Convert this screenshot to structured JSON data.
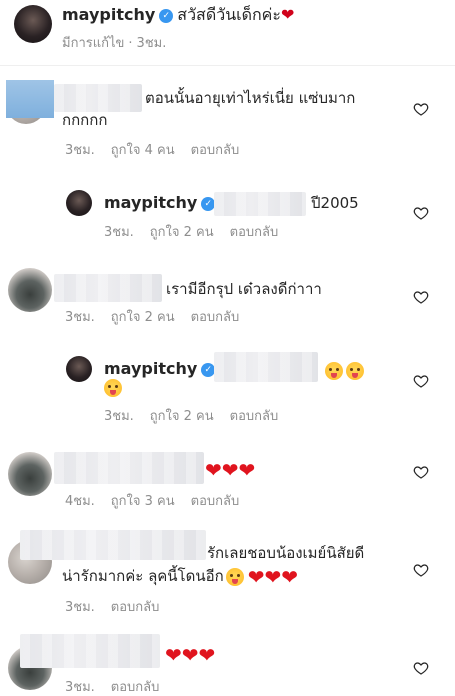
{
  "caption": {
    "username": "maypitchy",
    "text": "สวัสดีวันเด็กค่ะ",
    "heart": "❤",
    "edited": "มีการแก้ไข",
    "sep": "·",
    "time": "3ชม."
  },
  "comments": [
    {
      "text_line1": "ตอนนั้นอายุเท่าไหร่เนี่ย แซ่บมาก",
      "text_line2": "กกกกก",
      "time": "3ชม.",
      "likes": "ถูกใจ 4 คน",
      "reply": "ตอบกลับ"
    },
    {
      "username": "maypitchy",
      "text": "ปี2005",
      "time": "3ชม.",
      "likes": "ถูกใจ 2 คน",
      "reply": "ตอบกลับ"
    },
    {
      "text": "เรามีอีกรุป เด๋วลงดีก่าาา",
      "time": "3ชม.",
      "likes": "ถูกใจ 2 คน",
      "reply": "ตอบกลับ"
    },
    {
      "username": "maypitchy",
      "time": "3ชม.",
      "likes": "ถูกใจ 2 คน",
      "reply": "ตอบกลับ"
    },
    {
      "hearts": "❤❤❤",
      "time": "4ชม.",
      "likes": "ถูกใจ 3 คน",
      "reply": "ตอบกลับ"
    },
    {
      "text_line1": "รักเลยชอบน้องเมย์นิสัยดี",
      "text_line2": "น่ารักมากค่ะ ลุคนี้โดนอีก",
      "hearts": "❤❤❤",
      "time": "3ชม.",
      "reply": "ตอบกลับ"
    },
    {
      "hearts": "❤❤❤",
      "time": "3ชม.",
      "reply": "ตอบกลับ"
    }
  ],
  "colors": {
    "text": "#262626",
    "meta": "#8e8e8e",
    "verified": "#3897f0",
    "heart": "#e0141e"
  }
}
